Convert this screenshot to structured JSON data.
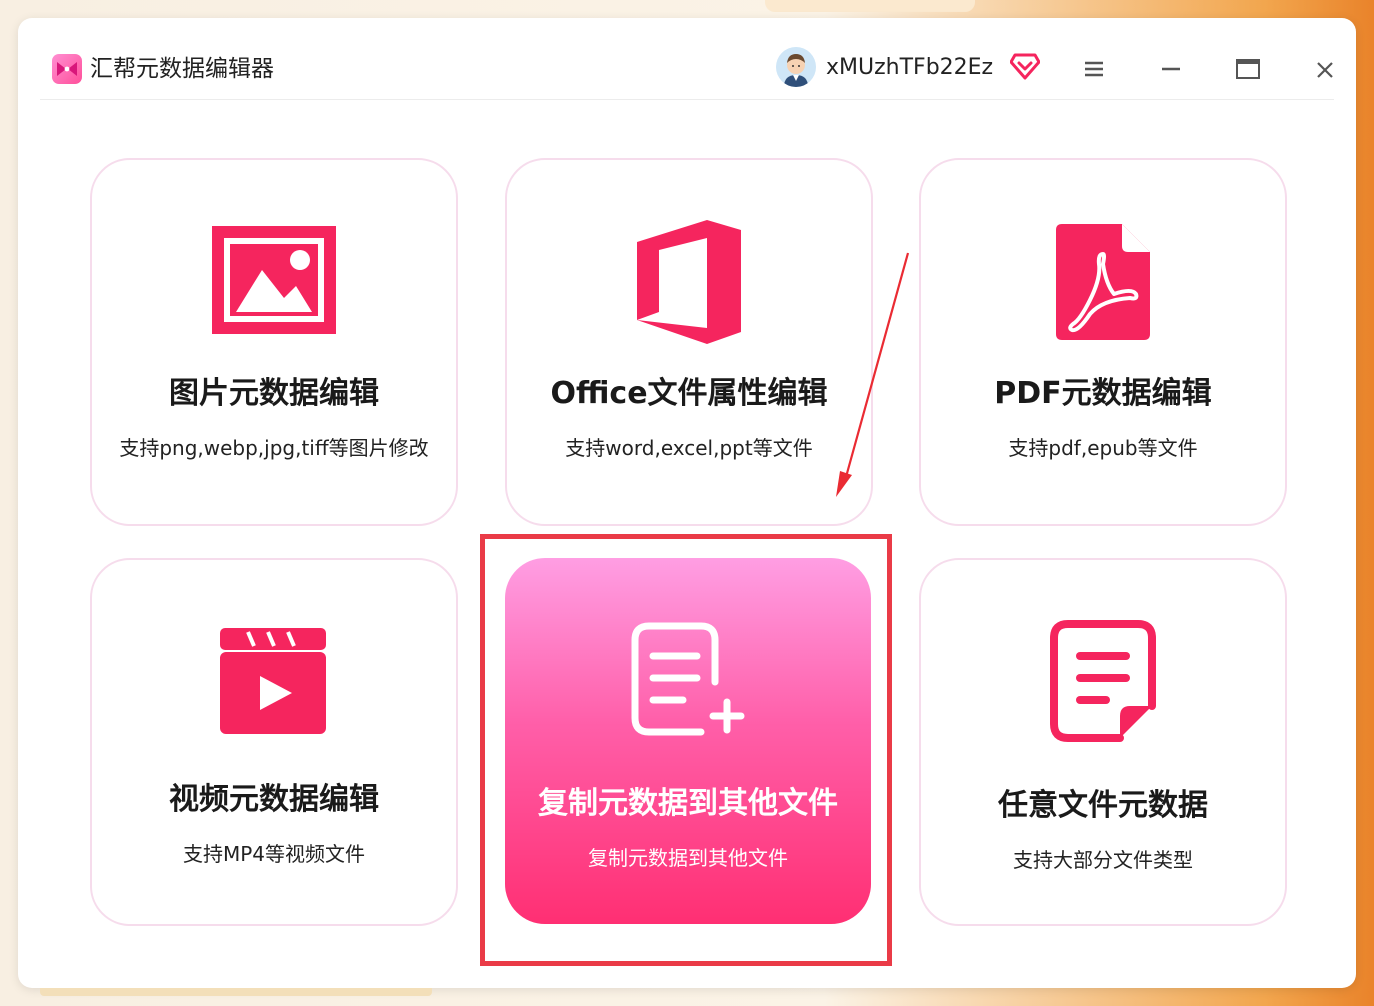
{
  "app": {
    "title": "汇帮元数据编辑器",
    "username": "xMUzhTFb22Ez"
  },
  "colors": {
    "accent": "#f5255e",
    "active_gradient_top": "#ff9ee3",
    "active_gradient_bottom": "#ff2f73",
    "highlight_border": "#ea3b47"
  },
  "cards": [
    {
      "title": "图片元数据编辑",
      "desc": "支持png,webp,jpg,tiff等图片修改",
      "icon": "image-icon"
    },
    {
      "title": "Office文件属性编辑",
      "desc": "支持word,excel,ppt等文件",
      "icon": "office-icon"
    },
    {
      "title": "PDF元数据编辑",
      "desc": "支持pdf,epub等文件",
      "icon": "pdf-icon"
    },
    {
      "title": "视频元数据编辑",
      "desc": "支持MP4等视频文件",
      "icon": "video-clapper-icon"
    },
    {
      "title": "复制元数据到其他文件",
      "desc": "复制元数据到其他文件",
      "icon": "document-add-icon",
      "active": true
    },
    {
      "title": "任意文件元数据",
      "desc": "支持大部分文件类型",
      "icon": "document-edit-icon"
    }
  ]
}
